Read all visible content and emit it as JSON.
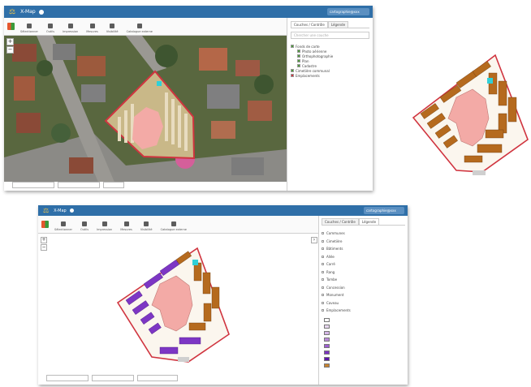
{
  "app": {
    "logo": "⚖",
    "title": "X-Map"
  },
  "user": "cartographie@xxx",
  "toolbar": [
    {
      "label": "Sélectionner",
      "icon": "cursor-icon"
    },
    {
      "label": "Outils",
      "icon": "wrench-icon"
    },
    {
      "label": "Impression",
      "icon": "print-icon"
    },
    {
      "label": "Mesures",
      "icon": "ruler-icon"
    },
    {
      "label": "Visibilité",
      "icon": "eye-icon"
    },
    {
      "label": "Catalogue externe",
      "icon": "catalog-icon"
    }
  ],
  "panel_top": {
    "tabs": [
      "Couches / Contrôle",
      "Légende"
    ],
    "search_placeholder": "Chercher une couche",
    "layers": [
      "Fonds de carte",
      "Photo aérienne",
      "Orthophotographie",
      "Plan",
      "Cadastre",
      "Cimetière communal",
      "Emplacements"
    ]
  },
  "status_top": {
    "coords": "",
    "scale": "",
    "proj": ""
  },
  "panel_bottom": {
    "tabs": [
      "Couches / Contrôle",
      "Légende"
    ],
    "legend_items": [
      "Communes",
      "Cimetière",
      "Bâtiments",
      "Allée",
      "Carré",
      "Rang",
      "Tombe",
      "Concession",
      "Monument",
      "Caveau",
      "Emplacements"
    ],
    "legend_swatches": [
      {
        "label": "",
        "color": "#ffffff"
      },
      {
        "label": "",
        "color": "#e7d7ef"
      },
      {
        "label": "",
        "color": "#d4b6e6"
      },
      {
        "label": "",
        "color": "#b98ad8"
      },
      {
        "label": "",
        "color": "#9d5fd0"
      },
      {
        "label": "",
        "color": "#7c34c2"
      },
      {
        "label": "",
        "color": "#5a16a8"
      },
      {
        "label": "",
        "color": "#c8832f"
      }
    ]
  },
  "status_bottom": {
    "coords": "",
    "scale": "",
    "proj": ""
  },
  "colors": {
    "header": "#2f6fa8",
    "boundary": "#d0343f",
    "church": "#f3aaa6",
    "graves_brown": "#b56a1e",
    "graves_purple": "#7d36c4"
  }
}
